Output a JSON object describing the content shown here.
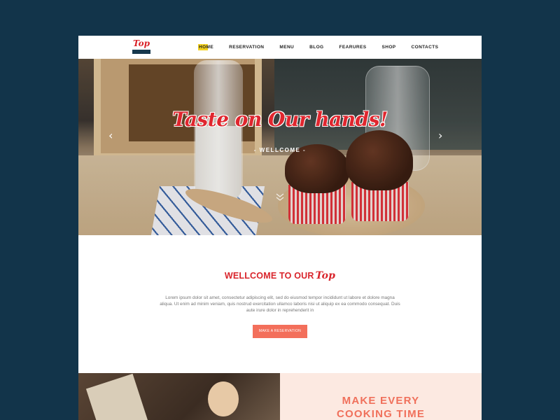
{
  "header": {
    "logo_text": "Top",
    "nav": [
      {
        "label": "HOME",
        "active": true
      },
      {
        "label": "RESERVATION",
        "active": false
      },
      {
        "label": "MENU",
        "active": false
      },
      {
        "label": "BLOG",
        "active": false
      },
      {
        "label": "FEARURES",
        "active": false
      },
      {
        "label": "SHOP",
        "active": false
      },
      {
        "label": "CONTACTS",
        "active": false
      }
    ]
  },
  "hero": {
    "title": "Taste on Our hands!",
    "subtitle": "- WELLCOME -",
    "prev_icon": "chevron-left-icon",
    "next_icon": "chevron-right-icon",
    "scroll_icon": "double-chevron-down-icon"
  },
  "welcome": {
    "title": "WELLCOME TO OUR",
    "title_script": "Top",
    "body": "Lorem ipsum dolor sit amet, consectetur adipiscing elit, sed do eiusmod tempor incididunt ut labore et dolore magna aliqua. Ut enim ad minim veniam, quis nostrud exercitation ullamco laboris nisi ut aliquip ex ea commodo consequat. Duis aute irure dolor in reprehenderit in",
    "button": "MAKE A RESERVATION"
  },
  "promo": {
    "title_line1": "MAKE EVERY",
    "title_line2": "COOKING TIME"
  },
  "colors": {
    "background": "#12344a",
    "brand_red": "#d9252c",
    "accent_coral": "#f36f5b",
    "nav_highlight": "#f4d21f",
    "promo_bg": "#fce9e1"
  }
}
